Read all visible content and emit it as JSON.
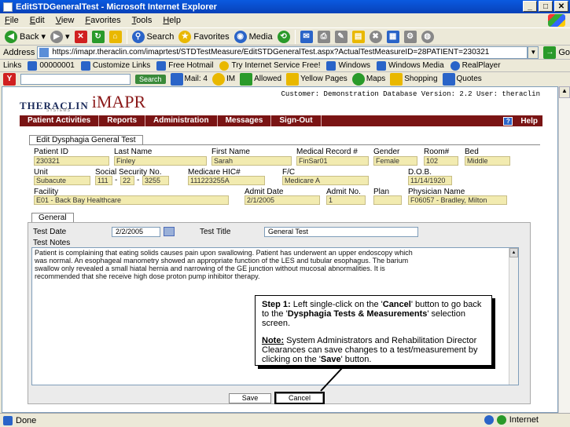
{
  "window": {
    "title": "EditSTDGeneralTest - Microsoft Internet Explorer"
  },
  "menu": [
    "File",
    "Edit",
    "View",
    "Favorites",
    "Tools",
    "Help"
  ],
  "toolbar": {
    "back": "Back",
    "search": "Search",
    "favorites": "Favorites",
    "media": "Media"
  },
  "address": {
    "label": "Address",
    "url": "https://imapr.theraclin.com/imaprtest/STDTestMeasure/EditSTDGeneralTest.aspx?ActualTestMeasureID=28PATIENT=230321",
    "go": "Go"
  },
  "links": {
    "label": "Links",
    "items": [
      "00000001",
      "Customize Links",
      "Free Hotmail",
      "Try Internet Service Free!",
      "Windows",
      "Windows Media",
      "RealPlayer"
    ]
  },
  "yahoo": {
    "search": "Search",
    "items": [
      "Mail: 4",
      "IM",
      "Allowed",
      "Yellow Pages",
      "Maps",
      "Shopping",
      "Quotes"
    ]
  },
  "brand": {
    "theraclin": "THERACLIN",
    "systems": "SYSTEMS",
    "imapr": "iMAPR"
  },
  "customer_line": "Customer: Demonstration Database Version: 2.2 User: theraclin",
  "nav": {
    "items": [
      "Patient Activities",
      "Reports",
      "Administration",
      "Messages",
      "Sign-Out"
    ],
    "help": "Help"
  },
  "main_tab": "Edit Dysphagia General Test",
  "labels": {
    "patient_id": "Patient ID",
    "last_name": "Last Name",
    "first_name": "First Name",
    "mrn": "Medical Record #",
    "gender": "Gender",
    "room": "Room#",
    "bed": "Bed",
    "unit": "Unit",
    "ssn": "Social Security No.",
    "hic": "Medicare HIC#",
    "fc": "F/C",
    "dob": "D.O.B.",
    "facility": "Facility",
    "admit_date": "Admit Date",
    "admit_no": "Admit No.",
    "plan": "Plan",
    "physician": "Physician Name"
  },
  "values": {
    "patient_id": "230321",
    "last_name": "Finley",
    "first_name": "Sarah",
    "mrn": "FinSar01",
    "gender": "Female",
    "room": "102",
    "bed": "Middle",
    "unit": "Subacute",
    "ssn1": "111",
    "ssn2": "22",
    "ssn3": "3255",
    "hic": "111223255A",
    "fc": "Medicare A",
    "dob": "11/14/1920",
    "facility": "E01 - Back Bay Healthcare",
    "admit_date": "2/1/2005",
    "admit_no": "1",
    "plan": "",
    "physician": "F06057 - Bradley, Milton"
  },
  "general_tab": "General",
  "test": {
    "date_label": "Test Date",
    "date": "2/2/2005",
    "title_label": "Test Title",
    "title": "General Test",
    "notes_label": "Test Notes"
  },
  "notes_lines": [
    "Patient is complaining that eating solids causes pain upon swallowing. Patient has underwent an upper endoscopy which",
    "was normal. An esophageal manometry showed an appropriate function of the LES and tubular esophagus. The barium",
    "swallow only revealed a small hiatal hernia and narrowing of the GE junction without mucosal abnormalities. It is",
    "recommended that she receive high dose proton pump inhibitor therapy."
  ],
  "buttons": {
    "save": "Save",
    "cancel": "Cancel"
  },
  "callout": {
    "step": "Step 1:",
    "line1": "Left single-click on the '",
    "cancel": "Cancel",
    "line1b": "' button to go back",
    "line2a": "to the '",
    "dysphagia": "Dysphagia Tests & Measurements",
    "line2b": "' selection",
    "line3": "screen.",
    "note": "Note:",
    "note_l1": " System Administrators and Rehabilitation Director",
    "note_l2": "Clearances can save changes to a test/measurement by",
    "note_l3a": "clicking on the '",
    "save": "Save",
    "note_l3b": "' button."
  },
  "status": {
    "left": "Done",
    "zone": "Internet"
  }
}
